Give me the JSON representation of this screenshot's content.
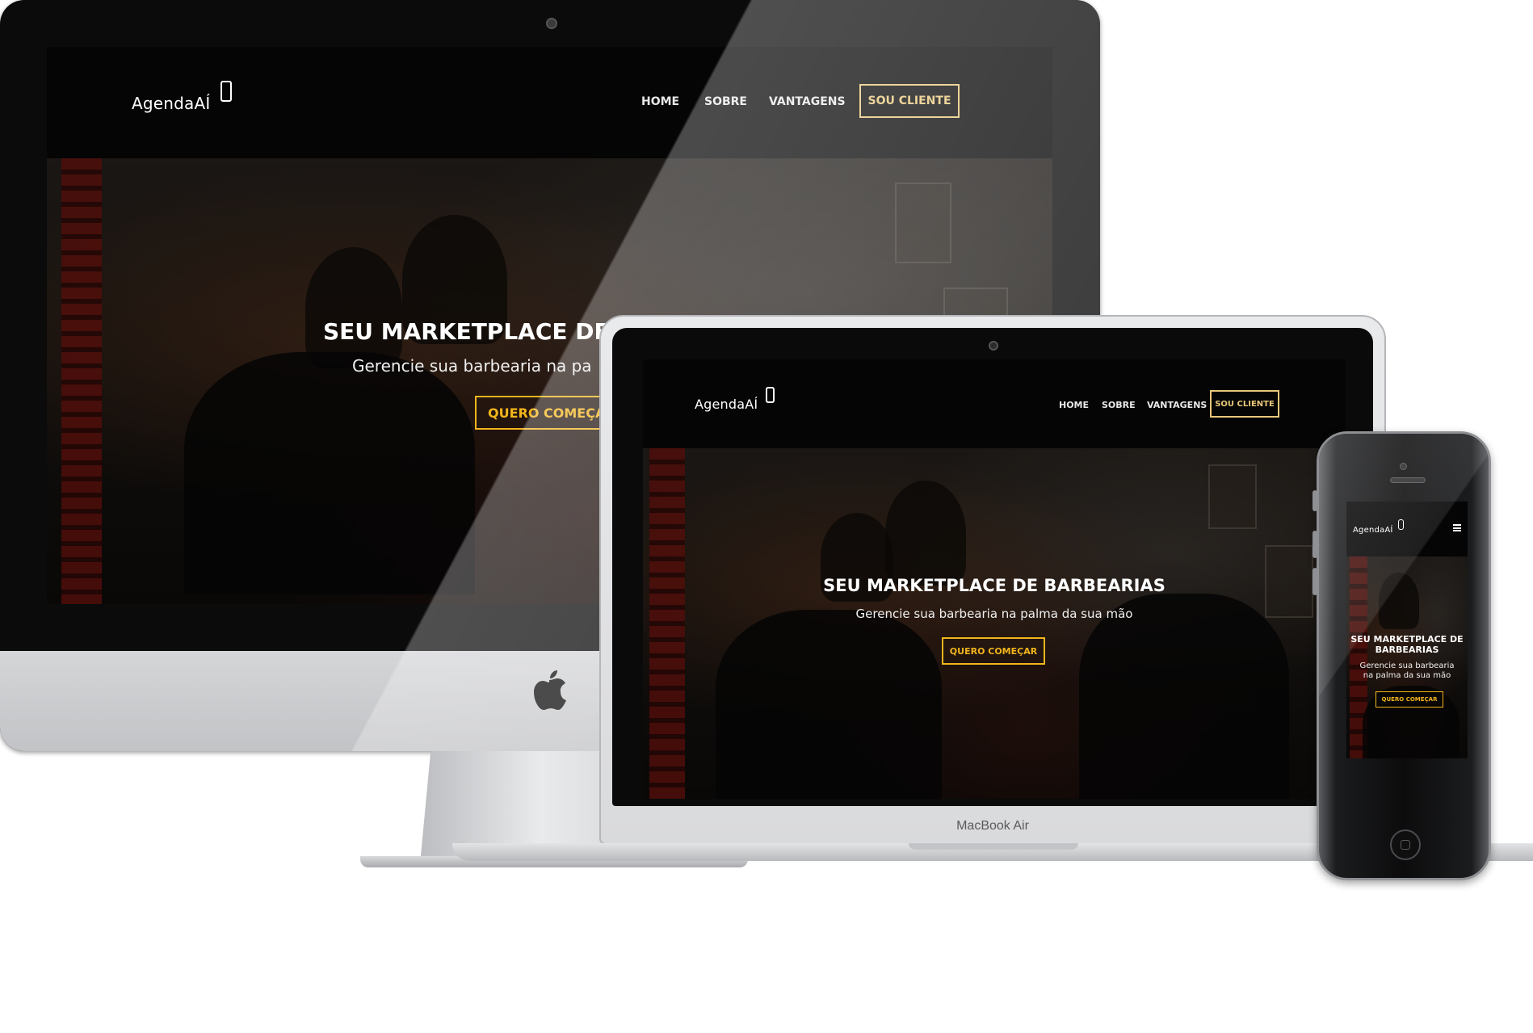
{
  "brand": {
    "name": "AgendaAÍ",
    "accent": "#e8c77a",
    "cta_color": "#f2b51c"
  },
  "nav": {
    "items": [
      "HOME",
      "SOBRE",
      "VANTAGENS"
    ],
    "cta": "SOU CLIENTE",
    "menu_icon": "hamburger-icon"
  },
  "hero": {
    "title": "SEU MARKETPLACE DE BARBEARIAS",
    "title_imac": "SEU MARKETPLACE DE",
    "title_phone_line1": "SEU MARKETPLACE DE",
    "title_phone_line2": "BARBEARIAS",
    "subtitle": "Gerencie sua barbearia na palma da sua mão",
    "subtitle_imac": "Gerencie sua barbearia na pa",
    "subtitle_phone_line1": "Gerencie sua barbearia",
    "subtitle_phone_line2": "na palma da sua mão",
    "button": "QUERO COMEÇAR",
    "button_imac": "QUERO COMEÇA"
  },
  "devices": {
    "macbook_label": "MacBook Air",
    "imac_logo": "apple-logo-icon"
  }
}
